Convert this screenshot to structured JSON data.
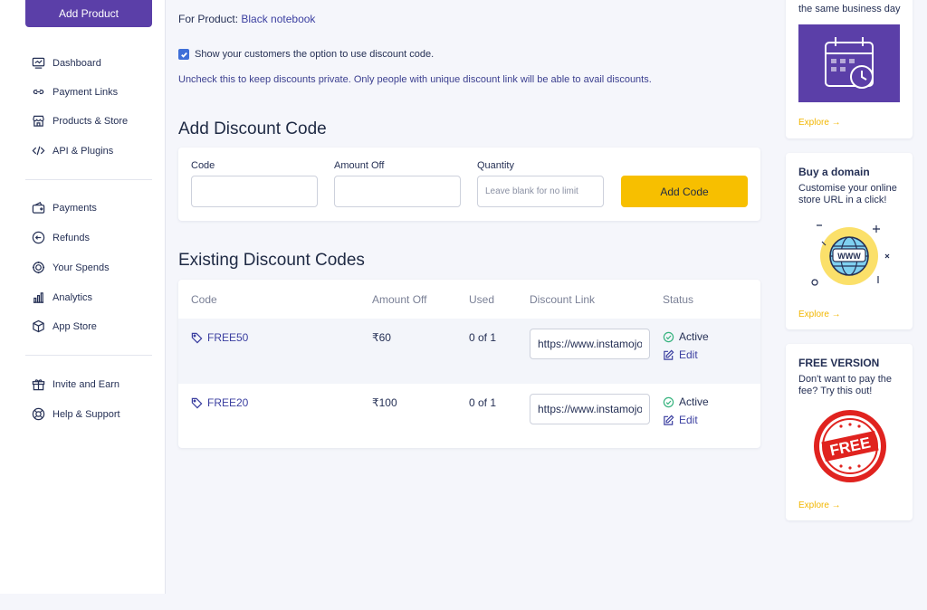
{
  "sidebar": {
    "add_product": "Add Product",
    "items": [
      {
        "label": "Dashboard",
        "icon": "dashboard-icon"
      },
      {
        "label": "Payment Links",
        "icon": "link-icon"
      },
      {
        "label": "Products & Store",
        "icon": "store-icon"
      },
      {
        "label": "API & Plugins",
        "icon": "code-icon"
      },
      {
        "label": "Payments",
        "icon": "payments-icon"
      },
      {
        "label": "Refunds",
        "icon": "refund-icon"
      },
      {
        "label": "Your Spends",
        "icon": "spends-icon"
      },
      {
        "label": "Analytics",
        "icon": "analytics-icon"
      },
      {
        "label": "App Store",
        "icon": "app-store-icon"
      },
      {
        "label": "Invite and Earn",
        "icon": "gift-icon"
      },
      {
        "label": "Help & Support",
        "icon": "support-icon"
      }
    ]
  },
  "main": {
    "for_product_label": "For Product:",
    "product_name": "Black notebook",
    "show_option_label": "Show your customers the option to use discount code.",
    "show_option_checked": true,
    "hint": "Uncheck this to keep discounts private. Only people with unique discount link will be able to avail discounts.",
    "add_title": "Add Discount Code",
    "form": {
      "code_label": "Code",
      "amount_label": "Amount Off",
      "quantity_label": "Quantity",
      "quantity_placeholder": "Leave blank for no limit",
      "add_button": "Add Code"
    },
    "existing_title": "Existing Discount Codes",
    "table": {
      "headers": [
        "Code",
        "Amount Off",
        "Used",
        "Discount Link",
        "Status"
      ],
      "rows": [
        {
          "code": "FREE50",
          "amount": "₹60",
          "used": "0 of 1",
          "link": "https://www.instamojo",
          "status": "Active",
          "edit": "Edit"
        },
        {
          "code": "FREE20",
          "amount": "₹100",
          "used": "0 of 1",
          "link": "https://www.instamojo",
          "status": "Active",
          "edit": "Edit"
        }
      ]
    }
  },
  "rail": {
    "card1_text": "the same business day",
    "card1_explore": "Explore →",
    "card2_title": "Buy a domain",
    "card2_text": "Customise your online store URL in a click!",
    "card2_image_text": "WWW",
    "card2_explore": "Explore →",
    "card3_title": "FREE VERSION",
    "card3_text": "Don't want to pay the fee? Try this out!",
    "card3_stamp": "FREE",
    "card3_explore": "Explore →"
  },
  "colors": {
    "brand": "#5b3fa8",
    "accent": "#f7bf00",
    "link": "#3b3fa0",
    "active": "#36b37e",
    "stamp": "#e0231f"
  }
}
